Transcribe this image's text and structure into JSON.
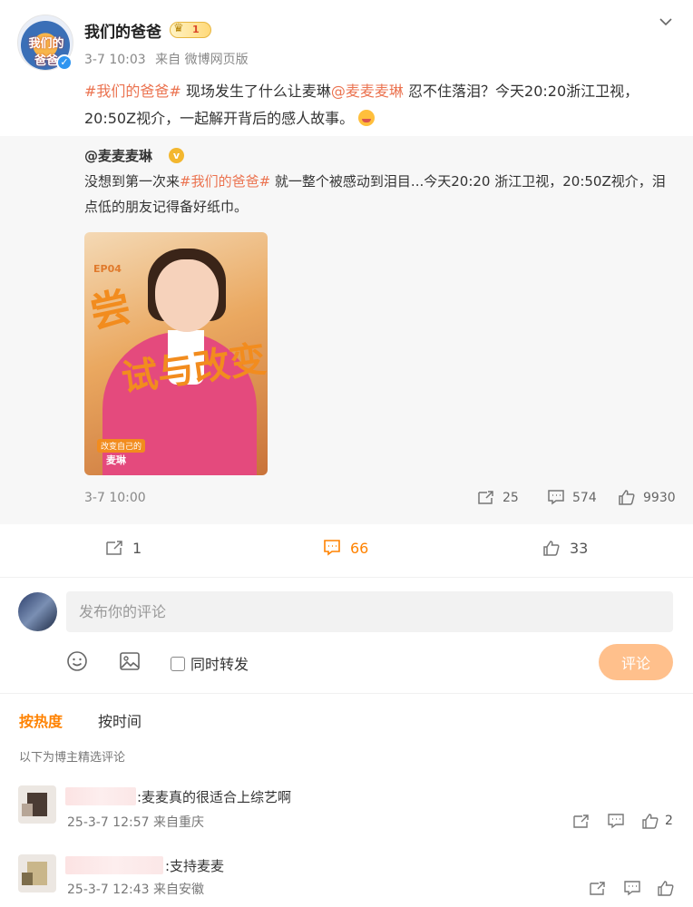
{
  "post": {
    "author": "我们的爸爸",
    "avatar_text": "我们的爸爸",
    "verified_mark": "✓",
    "badge_level": "1",
    "time": "3-7 10:03",
    "source": "来自 微博网页版",
    "text_parts": {
      "hashtag": "#我们的爸爸#",
      "mid1": " 现场发生了什么让麦琳",
      "mention": "@麦麦麦琳",
      "rest": " 忍不住落泪？今天20:20浙江卫视，20:50Z视介，一起解开背后的感人故事。"
    }
  },
  "repost": {
    "author": "@麦麦麦琳",
    "gold_mark": "v",
    "text_parts": {
      "start": "没想到第一次来",
      "hashtag": "#我们的爸爸#",
      "rest": " 就一整个被感动到泪目...今天20:20 浙江卫视，20:50Z视介，泪点低的朋友记得备好纸巾。"
    },
    "image": {
      "ep": "EP04",
      "title1": "尝",
      "title2": "试与改变",
      "tag": "改变自己的",
      "person": "麦琳"
    },
    "time": "3-7 10:00",
    "reposts": "25",
    "comments": "574",
    "likes": "9930"
  },
  "actions": {
    "reposts": "1",
    "comments": "66",
    "likes": "33"
  },
  "composer": {
    "placeholder": "发布你的评论",
    "also_repost_label": "同时转发",
    "submit_label": "评论"
  },
  "sort": {
    "hot": "按热度",
    "time": "按时间"
  },
  "note": "以下为博主精选评论",
  "comments": [
    {
      "text": ":麦麦真的很适合上综艺啊",
      "time": "25-3-7 12:57",
      "source": "来自重庆",
      "likes": "2"
    },
    {
      "text": ":支持麦麦",
      "time": "25-3-7 12:43",
      "source": "来自安徽",
      "likes": ""
    }
  ],
  "colors": {
    "accent": "#ff8200",
    "hashtag": "#eb7350",
    "verified": "#2f95f0",
    "submit_bg": "#ffc08c"
  },
  "icons": {
    "more": "chevron-down-icon",
    "repost": "repost-icon",
    "comment": "comment-icon",
    "like": "like-icon",
    "emoji": "smiley-icon",
    "image": "image-icon"
  }
}
